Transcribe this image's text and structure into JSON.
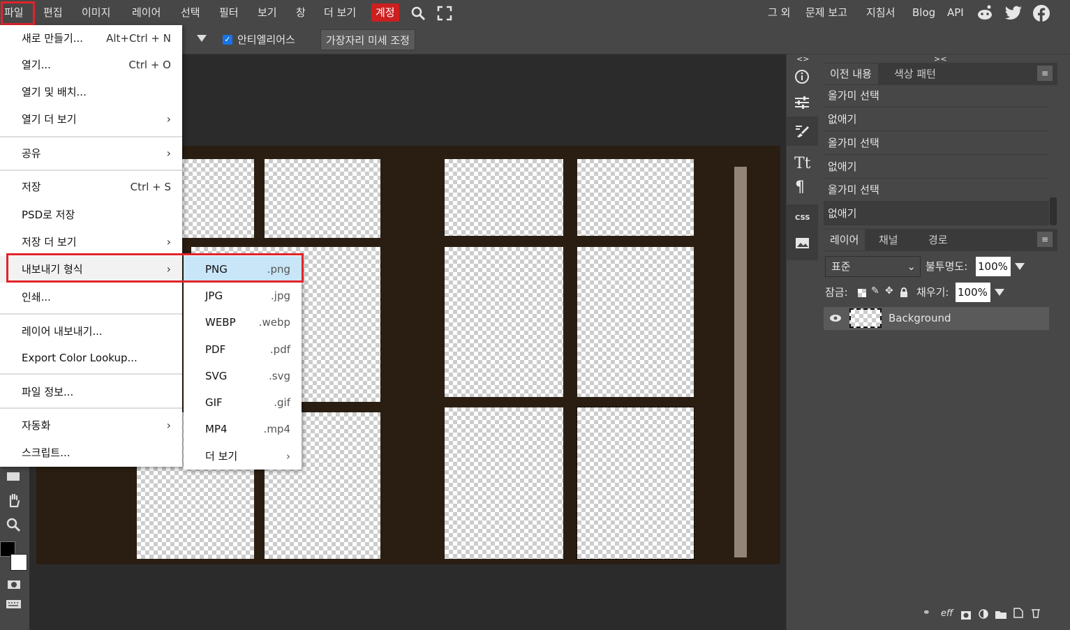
{
  "menubar": {
    "items": [
      "파일",
      "편집",
      "이미지",
      "레이어",
      "선택",
      "필터",
      "보기",
      "창",
      "더 보기",
      "계정"
    ],
    "right": [
      "그 외",
      "문제 보고",
      "지침서",
      "Blog",
      "API"
    ]
  },
  "options": {
    "antialias_label": "안티엘리어스",
    "refine_label": "가장자리 미세 조정"
  },
  "file_menu": {
    "items": [
      {
        "label": "새로 만들기...",
        "shortcut": "Alt+Ctrl + N"
      },
      {
        "label": "열기...",
        "shortcut": "Ctrl + O"
      },
      {
        "label": "열기 및 배치...",
        "shortcut": ""
      },
      {
        "label": "열기 더 보기",
        "shortcut": "›"
      },
      {
        "label": "공유",
        "shortcut": "›"
      },
      {
        "label": "저장",
        "shortcut": "Ctrl + S"
      },
      {
        "label": "PSD로 저장",
        "shortcut": ""
      },
      {
        "label": "저장 더 보기",
        "shortcut": "›"
      },
      {
        "label": "내보내기 형식",
        "shortcut": "›"
      },
      {
        "label": "인쇄...",
        "shortcut": ""
      },
      {
        "label": "레이어 내보내기...",
        "shortcut": ""
      },
      {
        "label": "Export Color Lookup...",
        "shortcut": ""
      },
      {
        "label": "파일 정보...",
        "shortcut": ""
      },
      {
        "label": "자동화",
        "shortcut": "›"
      },
      {
        "label": "스크립트...",
        "shortcut": ""
      }
    ]
  },
  "export_submenu": {
    "items": [
      {
        "label": "PNG",
        "ext": ".png"
      },
      {
        "label": "JPG",
        "ext": ".jpg"
      },
      {
        "label": "WEBP",
        "ext": ".webp"
      },
      {
        "label": "PDF",
        "ext": ".pdf"
      },
      {
        "label": "SVG",
        "ext": ".svg"
      },
      {
        "label": "GIF",
        "ext": ".gif"
      },
      {
        "label": "MP4",
        "ext": ".mp4"
      },
      {
        "label": "더 보기",
        "ext": "›"
      }
    ]
  },
  "history_panel": {
    "tabs": [
      "이전 내용",
      "색상 패턴"
    ],
    "items": [
      "올가미 선택",
      "없애기",
      "올가미 선택",
      "없애기",
      "올가미 선택",
      "없애기"
    ]
  },
  "layers_panel": {
    "tabs": [
      "레이어",
      "채널",
      "경로"
    ],
    "blend_mode": "표준",
    "opacity_label": "불투명도:",
    "opacity_value": "100%",
    "lock_label": "잠금:",
    "fill_label": "채우기:",
    "fill_value": "100%",
    "layer_name": "Background",
    "footer_eff": "eff"
  },
  "colors": {
    "highlight_red": "#e0242b",
    "account_red": "#cc1f1f",
    "selected_blue": "#c8e6f8"
  }
}
